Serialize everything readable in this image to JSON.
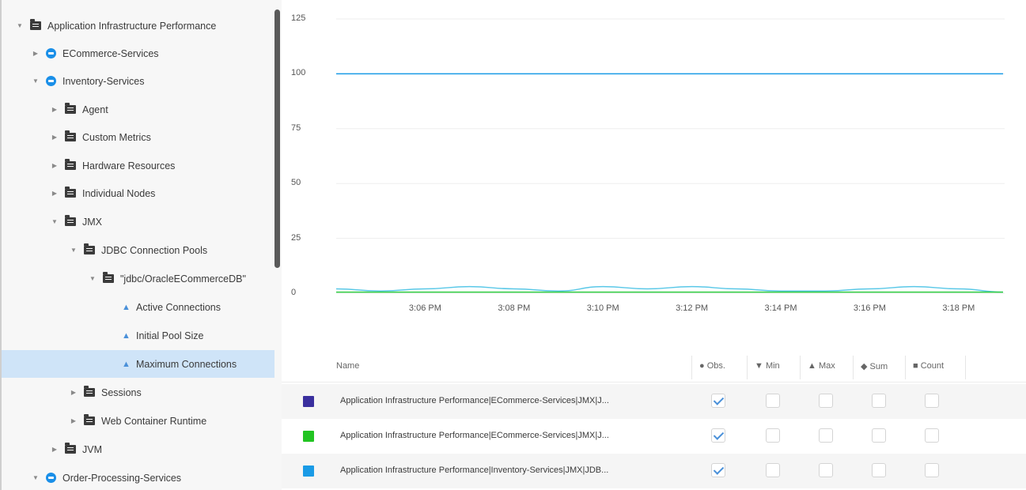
{
  "tree": {
    "items": [
      {
        "label": "Application Infrastructure Performance",
        "icon": "folder-icon",
        "expanded": true
      },
      {
        "label": "ECommerce-Services",
        "icon": "tier-icon",
        "expanded": false
      },
      {
        "label": "Inventory-Services",
        "icon": "tier-icon",
        "expanded": true
      },
      {
        "label": "Agent",
        "icon": "folder-icon",
        "expanded": false
      },
      {
        "label": "Custom Metrics",
        "icon": "folder-icon",
        "expanded": false
      },
      {
        "label": "Hardware Resources",
        "icon": "folder-icon",
        "expanded": false
      },
      {
        "label": "Individual Nodes",
        "icon": "folder-icon",
        "expanded": false
      },
      {
        "label": "JMX",
        "icon": "folder-icon",
        "expanded": true
      },
      {
        "label": "JDBC Connection Pools",
        "icon": "folder-icon",
        "expanded": true
      },
      {
        "label": "\"jdbc/OracleECommerceDB\"",
        "icon": "folder-icon",
        "expanded": true
      },
      {
        "label": "Active Connections",
        "icon": "metric-icon"
      },
      {
        "label": "Initial Pool Size",
        "icon": "metric-icon"
      },
      {
        "label": "Maximum Connections",
        "icon": "metric-icon",
        "selected": true
      },
      {
        "label": "Sessions",
        "icon": "folder-icon",
        "expanded": false
      },
      {
        "label": "Web Container Runtime",
        "icon": "folder-icon",
        "expanded": false
      },
      {
        "label": "JVM",
        "icon": "folder-icon",
        "expanded": false
      },
      {
        "label": "Order-Processing-Services",
        "icon": "tier-icon",
        "expanded": true
      }
    ]
  },
  "chart_data": {
    "type": "line",
    "ylim": [
      0,
      125
    ],
    "y_ticks": [
      "125",
      "100",
      "75",
      "50",
      "25",
      "0"
    ],
    "x_ticks": [
      "3:06 PM",
      "3:08 PM",
      "3:10 PM",
      "3:12 PM",
      "3:14 PM",
      "3:16 PM",
      "3:18 PM"
    ],
    "grid": true,
    "series": [
      {
        "color": "#1a9be6",
        "x": [
          "3:04 PM",
          "3:19 PM"
        ],
        "y": [
          100,
          100
        ]
      },
      {
        "color": "#5ac8e8",
        "x": [
          "3:04 PM",
          "3:05 PM",
          "3:06 PM",
          "3:07 PM",
          "3:08 PM",
          "3:09 PM",
          "3:10 PM",
          "3:11 PM",
          "3:12 PM",
          "3:13 PM",
          "3:14 PM",
          "3:15 PM",
          "3:16 PM",
          "3:17 PM",
          "3:18 PM",
          "3:19 PM"
        ],
        "y": [
          2,
          1,
          2,
          3,
          2,
          1,
          3,
          2,
          3,
          2,
          1,
          1,
          2,
          3,
          2,
          0.5
        ]
      },
      {
        "color": "#2ecc40",
        "x": [
          "3:04 PM",
          "3:19 PM"
        ],
        "y": [
          0.5,
          0.5
        ]
      }
    ]
  },
  "table": {
    "headers": {
      "name": "Name",
      "obs": "● Obs.",
      "min": "▼ Min",
      "max": "▲ Max",
      "sum": "◆ Sum",
      "count": "■ Count"
    },
    "rows": [
      {
        "color": "#3a2f9e",
        "name": "Application Infrastructure Performance|ECommerce-Services|JMX|J...",
        "obs": true,
        "min": false,
        "max": false,
        "sum": false,
        "count": false
      },
      {
        "color": "#22c422",
        "name": "Application Infrastructure Performance|ECommerce-Services|JMX|J...",
        "obs": true,
        "min": false,
        "max": false,
        "sum": false,
        "count": false
      },
      {
        "color": "#1a9be6",
        "name": "Application Infrastructure Performance|Inventory-Services|JMX|JDB...",
        "obs": true,
        "min": false,
        "max": false,
        "sum": false,
        "count": false
      }
    ]
  }
}
